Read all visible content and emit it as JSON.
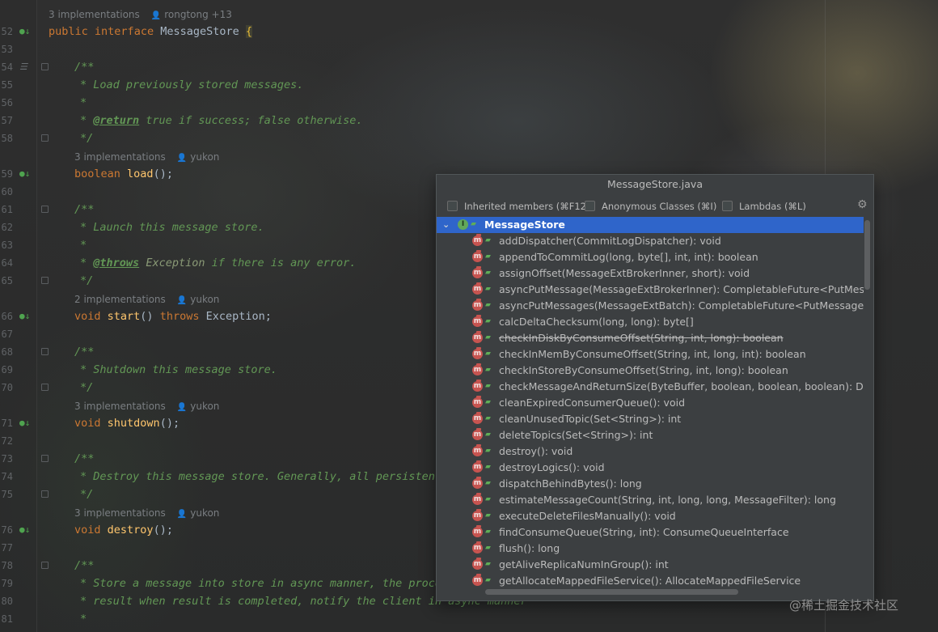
{
  "editor": {
    "lines": [
      {
        "num": "52",
        "hint": null
      },
      {
        "num": "53"
      },
      {
        "num": "54"
      },
      {
        "num": "55"
      },
      {
        "num": "56"
      },
      {
        "num": "57"
      },
      {
        "num": "58"
      },
      {
        "num": "59"
      },
      {
        "num": "60"
      },
      {
        "num": "61"
      },
      {
        "num": "62"
      },
      {
        "num": "63"
      },
      {
        "num": "64"
      },
      {
        "num": "65"
      },
      {
        "num": "66"
      },
      {
        "num": "67"
      },
      {
        "num": "68"
      },
      {
        "num": "69"
      },
      {
        "num": "70"
      },
      {
        "num": "71"
      },
      {
        "num": "72"
      },
      {
        "num": "73"
      },
      {
        "num": "74"
      },
      {
        "num": "75"
      },
      {
        "num": "76"
      },
      {
        "num": "77"
      },
      {
        "num": "78"
      },
      {
        "num": "79"
      },
      {
        "num": "80"
      },
      {
        "num": "81"
      }
    ],
    "hints": {
      "h0": {
        "count": "3 implementations",
        "author": "rongtong +13"
      },
      "h1": {
        "count": "3 implementations",
        "author": "yukon"
      },
      "h2": {
        "count": "2 implementations",
        "author": "yukon"
      },
      "h3": {
        "count": "3 implementations",
        "author": "yukon"
      },
      "h4": {
        "count": "3 implementations",
        "author": "yukon"
      }
    },
    "code": {
      "l52a": "public",
      "l52b": "interface",
      "l52c": "MessageStore",
      "l54": "/**",
      "l55": "* Load previously stored messages.",
      "l56": "*",
      "l57tag": "@return",
      "l57rest": " true if success; false otherwise.",
      "l58": "*/",
      "l59a": "boolean",
      "l59b": "load",
      "l59c": "();",
      "l61": "/**",
      "l62": "* Launch this message store.",
      "l63": "*",
      "l64tag": "@throws",
      "l64ref": "Exception",
      "l64rest": " if there is any error.",
      "l65": "*/",
      "l66a": "void",
      "l66b": "start",
      "l66c": "()",
      "l66d": "throws",
      "l66e": "Exception;",
      "l68": "/**",
      "l69": "* Shutdown this message store.",
      "l70": "*/",
      "l71a": "void",
      "l71b": "shutdown",
      "l71c": "();",
      "l73": "/**",
      "l74": "* Destroy this message store. Generally, all persistent",
      "l75": "*/",
      "l76a": "void",
      "l76b": "destroy",
      "l76c": "();",
      "l78": "/**",
      "l79": "* Store a message into store in async manner, the proce",
      "l80": "* result when result is completed, notify the client in async manner",
      "l81": "*"
    }
  },
  "popup": {
    "title": "MessageStore.java",
    "filters": {
      "inherited": "Inherited members (⌘F12)",
      "anonymous": "Anonymous Classes (⌘I)",
      "lambdas": "Lambdas (⌘L)"
    },
    "root": "MessageStore",
    "members": [
      "addDispatcher(CommitLogDispatcher): void",
      "appendToCommitLog(long, byte[], int, int): boolean",
      "assignOffset(MessageExtBrokerInner, short): void",
      "asyncPutMessage(MessageExtBrokerInner): CompletableFuture<PutMess",
      "asyncPutMessages(MessageExtBatch): CompletableFuture<PutMessageR",
      "calcDeltaChecksum(long, long): byte[]",
      "checkInDiskByConsumeOffset(String, int, long): boolean",
      "checkInMemByConsumeOffset(String, int, long, int): boolean",
      "checkInStoreByConsumeOffset(String, int, long): boolean",
      "checkMessageAndReturnSize(ByteBuffer, boolean, boolean, boolean): Dis",
      "cleanExpiredConsumerQueue(): void",
      "cleanUnusedTopic(Set<String>): int",
      "deleteTopics(Set<String>): int",
      "destroy(): void",
      "destroyLogics(): void",
      "dispatchBehindBytes(): long",
      "estimateMessageCount(String, int, long, long, MessageFilter): long",
      "executeDeleteFilesManually(): void",
      "findConsumeQueue(String, int): ConsumeQueueInterface",
      "flush(): long",
      "getAliveReplicaNumInGroup(): int",
      "getAllocateMappedFileService(): AllocateMappedFileService"
    ]
  },
  "watermark": "@稀土掘金技术社区"
}
